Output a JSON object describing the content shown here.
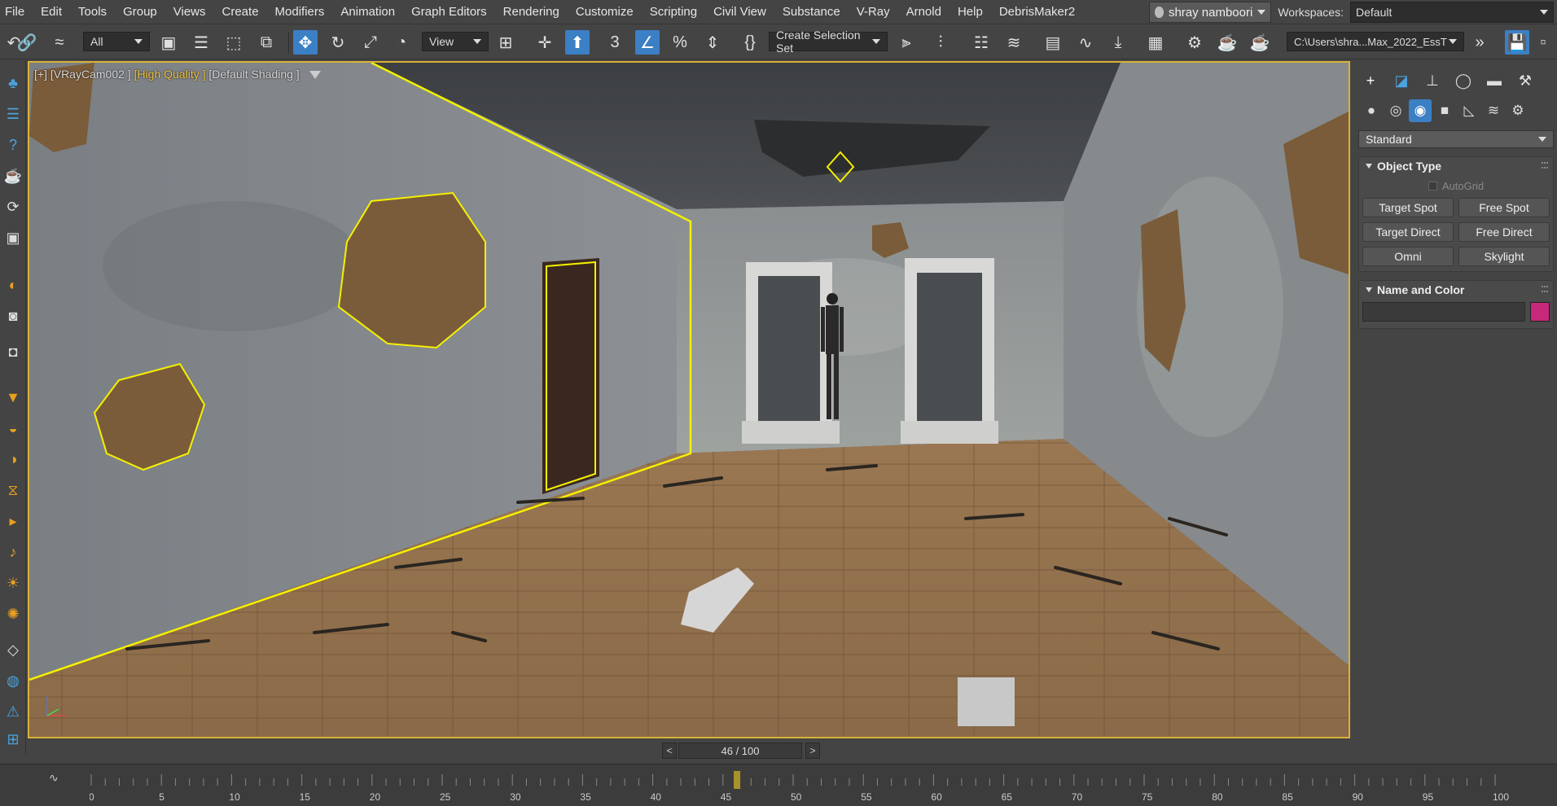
{
  "menu": [
    "File",
    "Edit",
    "Tools",
    "Group",
    "Views",
    "Create",
    "Modifiers",
    "Animation",
    "Graph Editors",
    "Rendering",
    "Customize",
    "Scripting",
    "Civil View",
    "Substance",
    "V-Ray",
    "Arnold",
    "Help",
    "DebrisMaker2"
  ],
  "user": {
    "name": "shray namboori"
  },
  "workspaces": {
    "label": "Workspaces:",
    "value": "Default"
  },
  "toolbar": {
    "selection_filter": "All",
    "ref_coord": "View",
    "named_selection": "Create Selection Set",
    "project_path": "C:\\Users\\shra...Max_2022_EssT"
  },
  "viewport": {
    "label_prefix": "[+] [VRayCam002 ]",
    "label_quality": "[High Quality ]",
    "label_shading": "[Default Shading ]"
  },
  "command_panel": {
    "category": "Standard",
    "object_type": {
      "title": "Object Type",
      "autogrid": "AutoGrid",
      "buttons": [
        "Target Spot",
        "Free Spot",
        "Target Direct",
        "Free Direct",
        "Omni",
        "Skylight"
      ]
    },
    "name_and_color": {
      "title": "Name and Color",
      "name_value": "",
      "color": "#c8287a"
    }
  },
  "time_slider": {
    "frame_text": "46 / 100",
    "prev": "<",
    "next": ">",
    "current": 46,
    "end": 100
  },
  "trackbar": {
    "tick_labels": [
      "0",
      "5",
      "10",
      "15",
      "20",
      "25",
      "30",
      "35",
      "40",
      "45",
      "50",
      "55",
      "60",
      "65",
      "70",
      "75",
      "80",
      "85",
      "90",
      "95",
      "100"
    ]
  }
}
